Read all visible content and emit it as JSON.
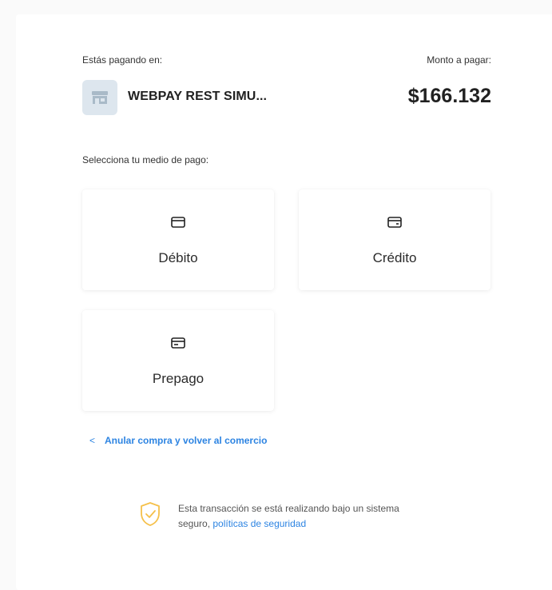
{
  "header": {
    "paying_label": "Estás pagando en:",
    "merchant_name": "WEBPAY REST SIMU...",
    "merchant_icon": "storefront-icon",
    "amount_label": "Monto a pagar:",
    "amount_value": "$166.132"
  },
  "payment": {
    "select_label": "Selecciona tu medio de pago:",
    "methods": [
      {
        "label": "Débito",
        "icon": "debit-card-icon"
      },
      {
        "label": "Crédito",
        "icon": "credit-card-icon"
      },
      {
        "label": "Prepago",
        "icon": "prepaid-card-icon"
      }
    ]
  },
  "cancel": {
    "chevron": "<",
    "label": "Anular compra y volver al comercio"
  },
  "security": {
    "icon": "shield-check-icon",
    "text": "Esta transacción se está realizando bajo un sistema seguro,",
    "link": "políticas de seguridad"
  },
  "colors": {
    "accent": "#2d84e2",
    "shield": "#f5c04a",
    "merchant_bg": "#dde6ee"
  }
}
